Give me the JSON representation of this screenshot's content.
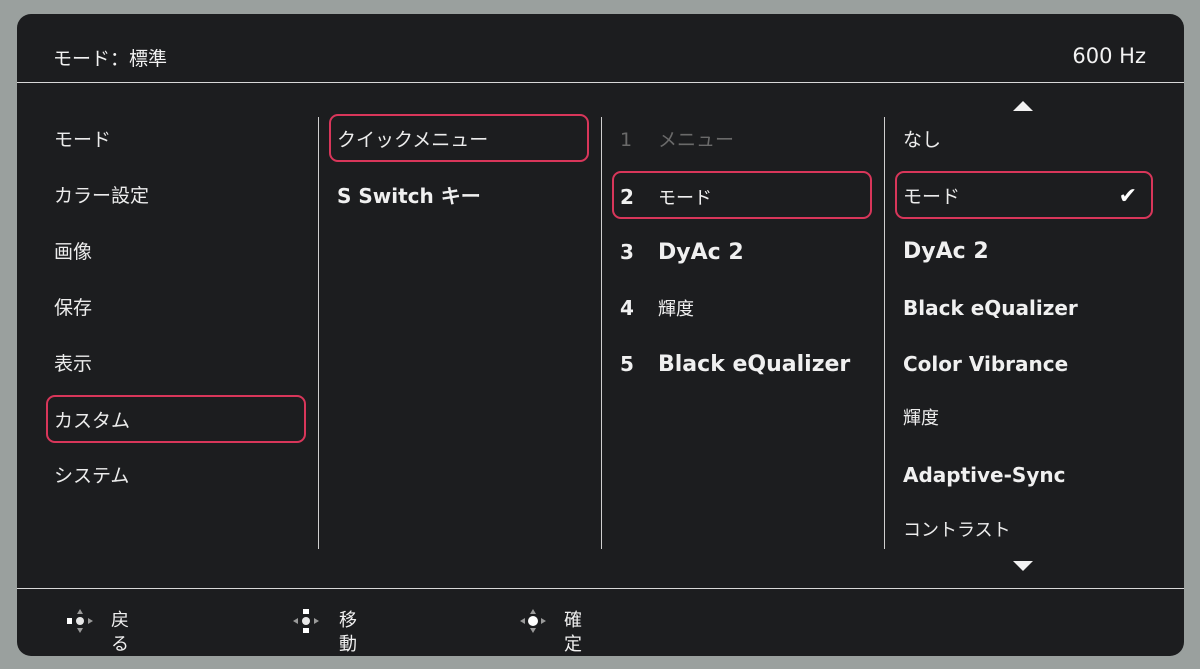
{
  "header": {
    "title": "モード：標準",
    "refresh_rate": "600 Hz"
  },
  "menu": {
    "col1": [
      "モード",
      "カラー設定",
      "画像",
      "保存",
      "表示",
      "カスタム",
      "システム"
    ],
    "col1_selected": "カスタム",
    "col2": [
      "クイックメニュー",
      "S Switch キー"
    ],
    "col2_selected": "クイックメニュー",
    "col3": [
      {
        "num": "1",
        "label": "メニュー",
        "disabled": true
      },
      {
        "num": "2",
        "label": "モード",
        "selected": true
      },
      {
        "num": "3",
        "label": "DyAc 2"
      },
      {
        "num": "4",
        "label": "輝度"
      },
      {
        "num": "5",
        "label": "Black eQualizer"
      }
    ],
    "col4": [
      "なし",
      "モード",
      "DyAc 2",
      "Black eQualizer",
      "Color Vibrance",
      "輝度",
      "Adaptive-Sync",
      "コントラスト"
    ],
    "col4_selected": "モード",
    "col4_check_icon": "checkmark-icon",
    "scroll_up_icon": "scroll-up-arrow-icon",
    "scroll_down_icon": "scroll-down-arrow-icon"
  },
  "footer": {
    "back": {
      "icon": "dpad-left-icon",
      "label": "戻る"
    },
    "move": {
      "icon": "dpad-updown-icon",
      "label": "移動"
    },
    "confirm": {
      "icon": "dpad-center-icon",
      "label": "確定"
    }
  },
  "colors": {
    "selection_border": "#d8365a",
    "background": "#1c1d1f",
    "divider": "#cfcfcf"
  }
}
